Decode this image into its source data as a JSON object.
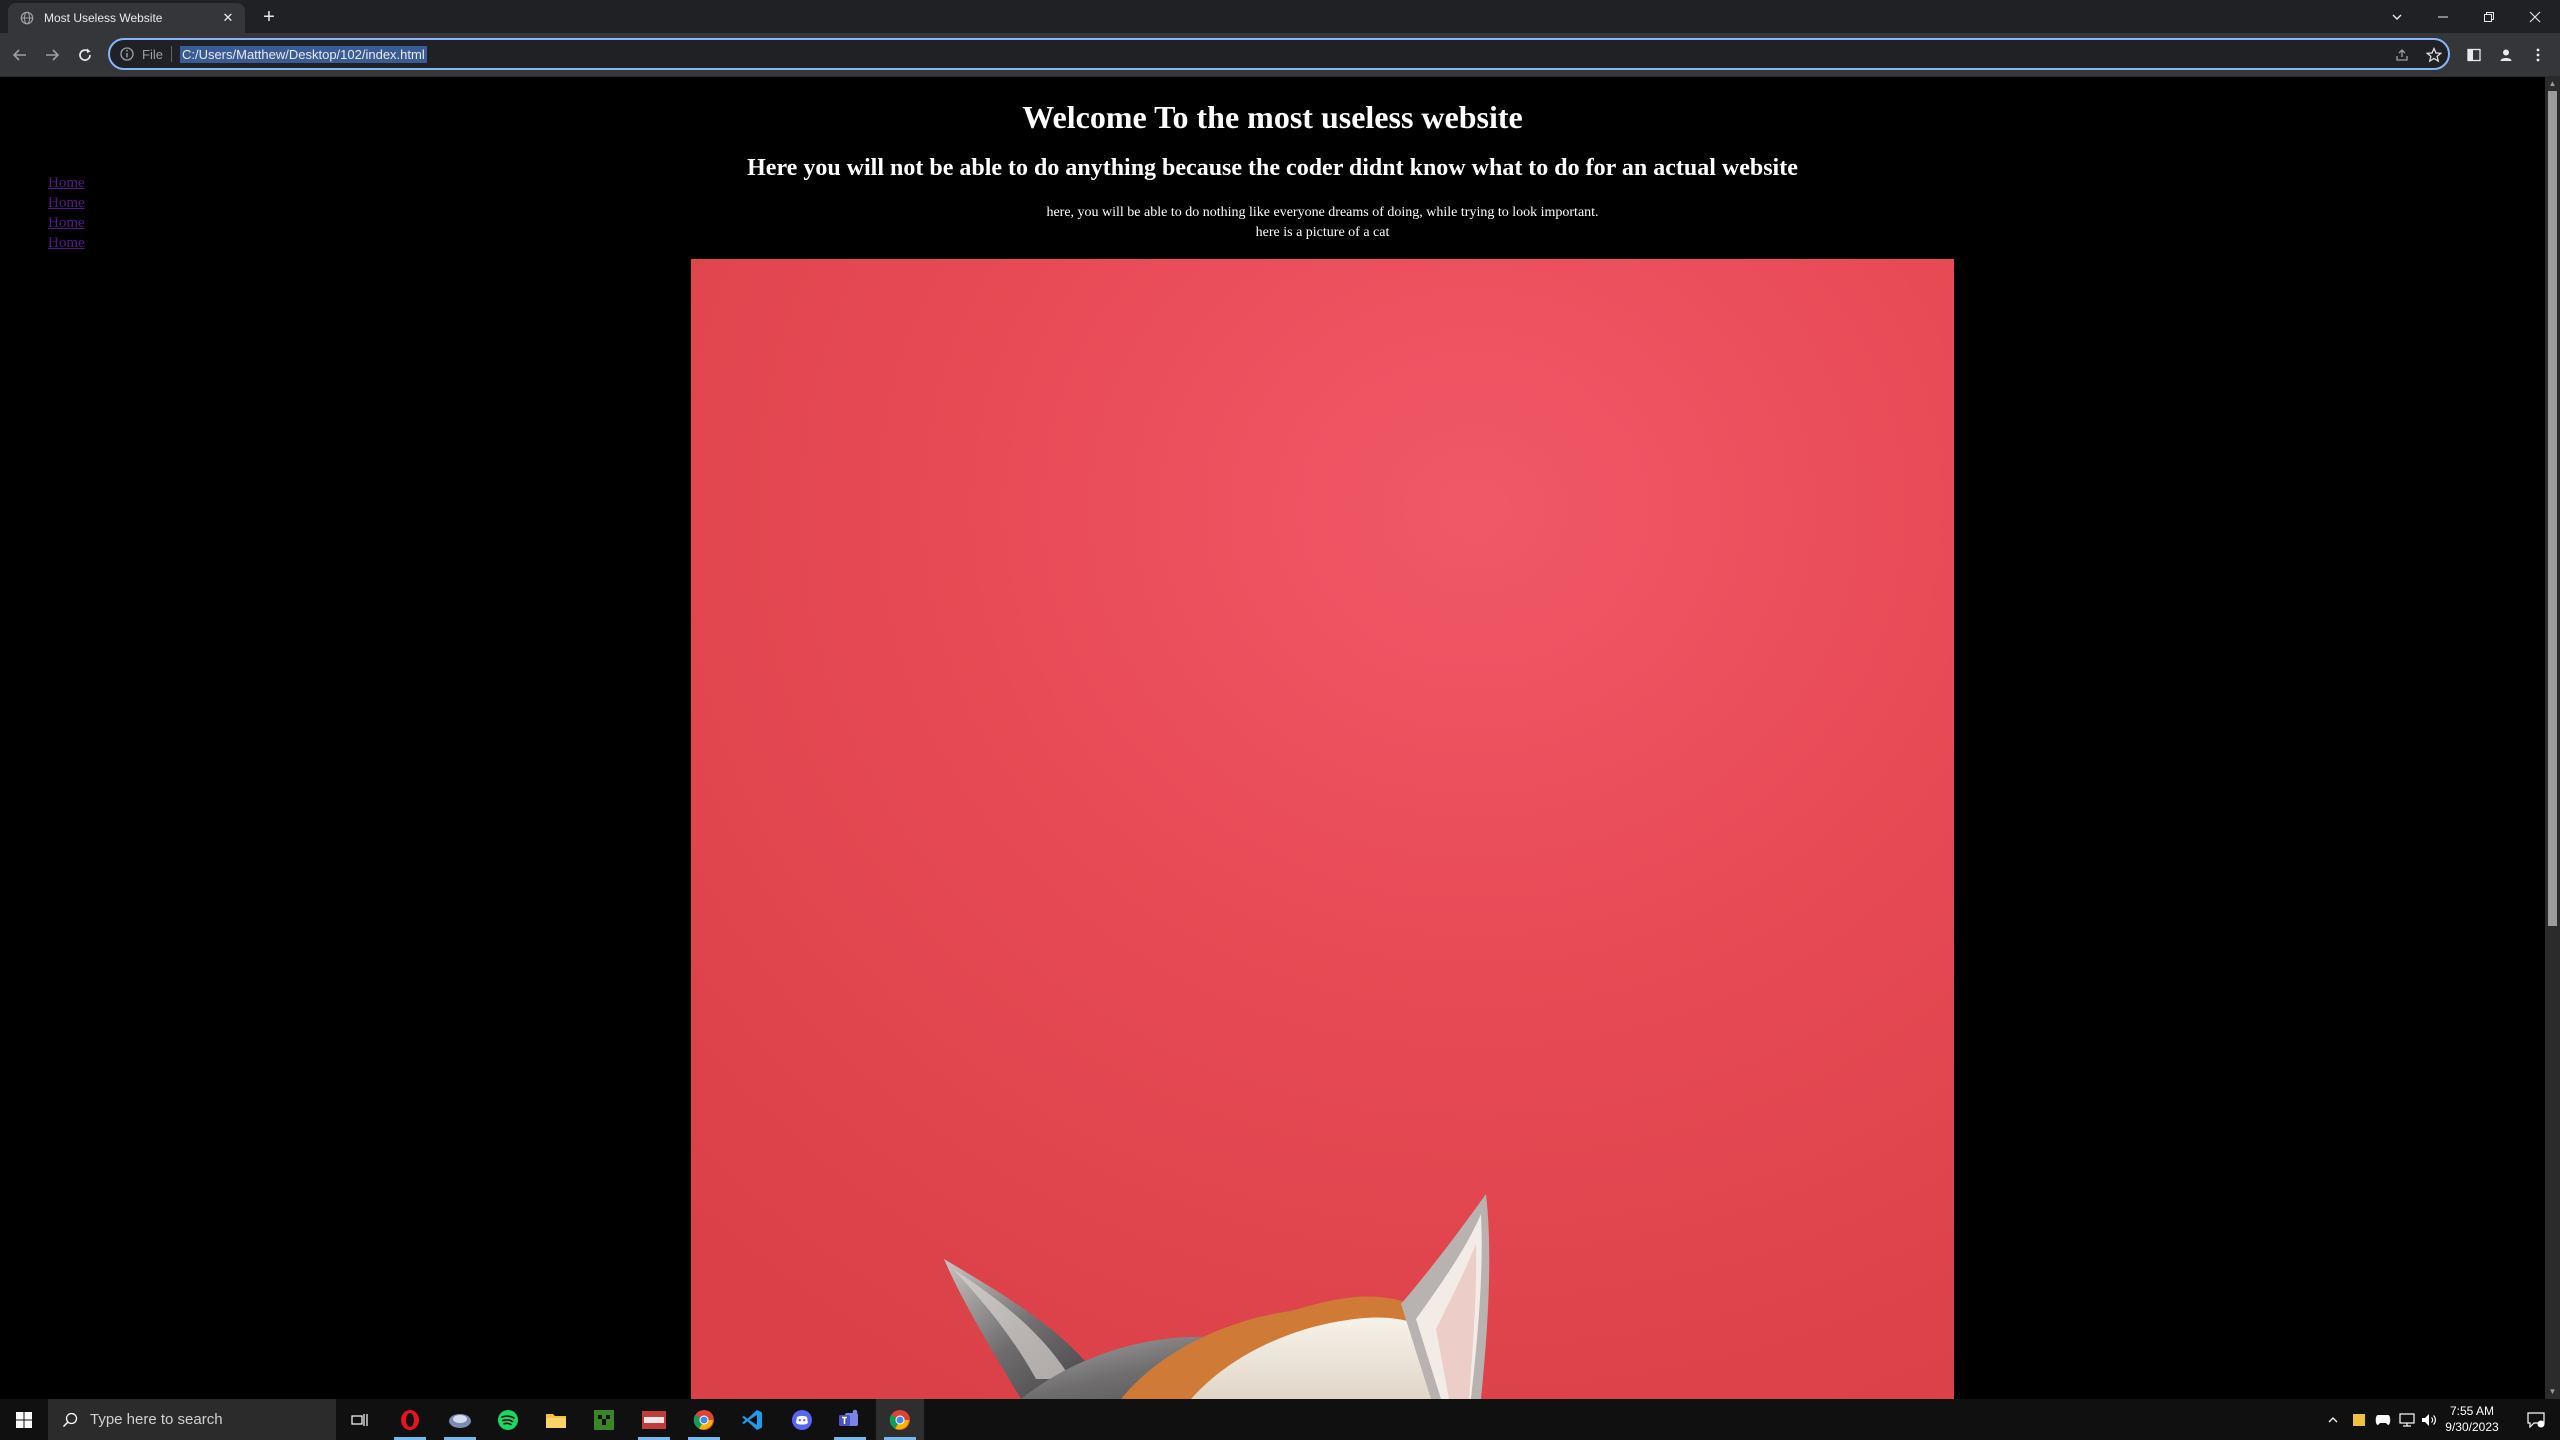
{
  "browser": {
    "tab_title": "Most Useless Website",
    "tab_close": "✕",
    "new_tab": "+",
    "url_scheme": "File",
    "url": "C:/Users/Matthew/Desktop/102/index.html"
  },
  "page": {
    "heading": "Welcome To the most useless website",
    "subheading": "Here you will not be able to do anything because the coder didnt know what to do for an actual website",
    "paragraph_line1": "here, you will be able to do nothing like everyone dreams of doing, while trying to look important.",
    "paragraph_line2": "here is a picture of a cat",
    "nav_links": [
      "Home",
      "Home",
      "Home",
      "Home"
    ],
    "image_description": "cat peeking up from bottom against red background"
  },
  "taskbar": {
    "search_placeholder": "Type here to search",
    "time": "7:55 AM",
    "date": "9/30/2023",
    "apps": [
      "start-icon",
      "task-view-icon",
      "opera-icon",
      "app-icon",
      "spotify-icon",
      "file-explorer-icon",
      "minecraft-icon",
      "app-icon-2",
      "chrome-icon",
      "vscode-icon",
      "discord-icon",
      "teams-icon",
      "chrome-active-icon"
    ]
  },
  "colors": {
    "accent": "#8ab4f8",
    "link": "#551a8b",
    "image_background": "#e84a55"
  }
}
